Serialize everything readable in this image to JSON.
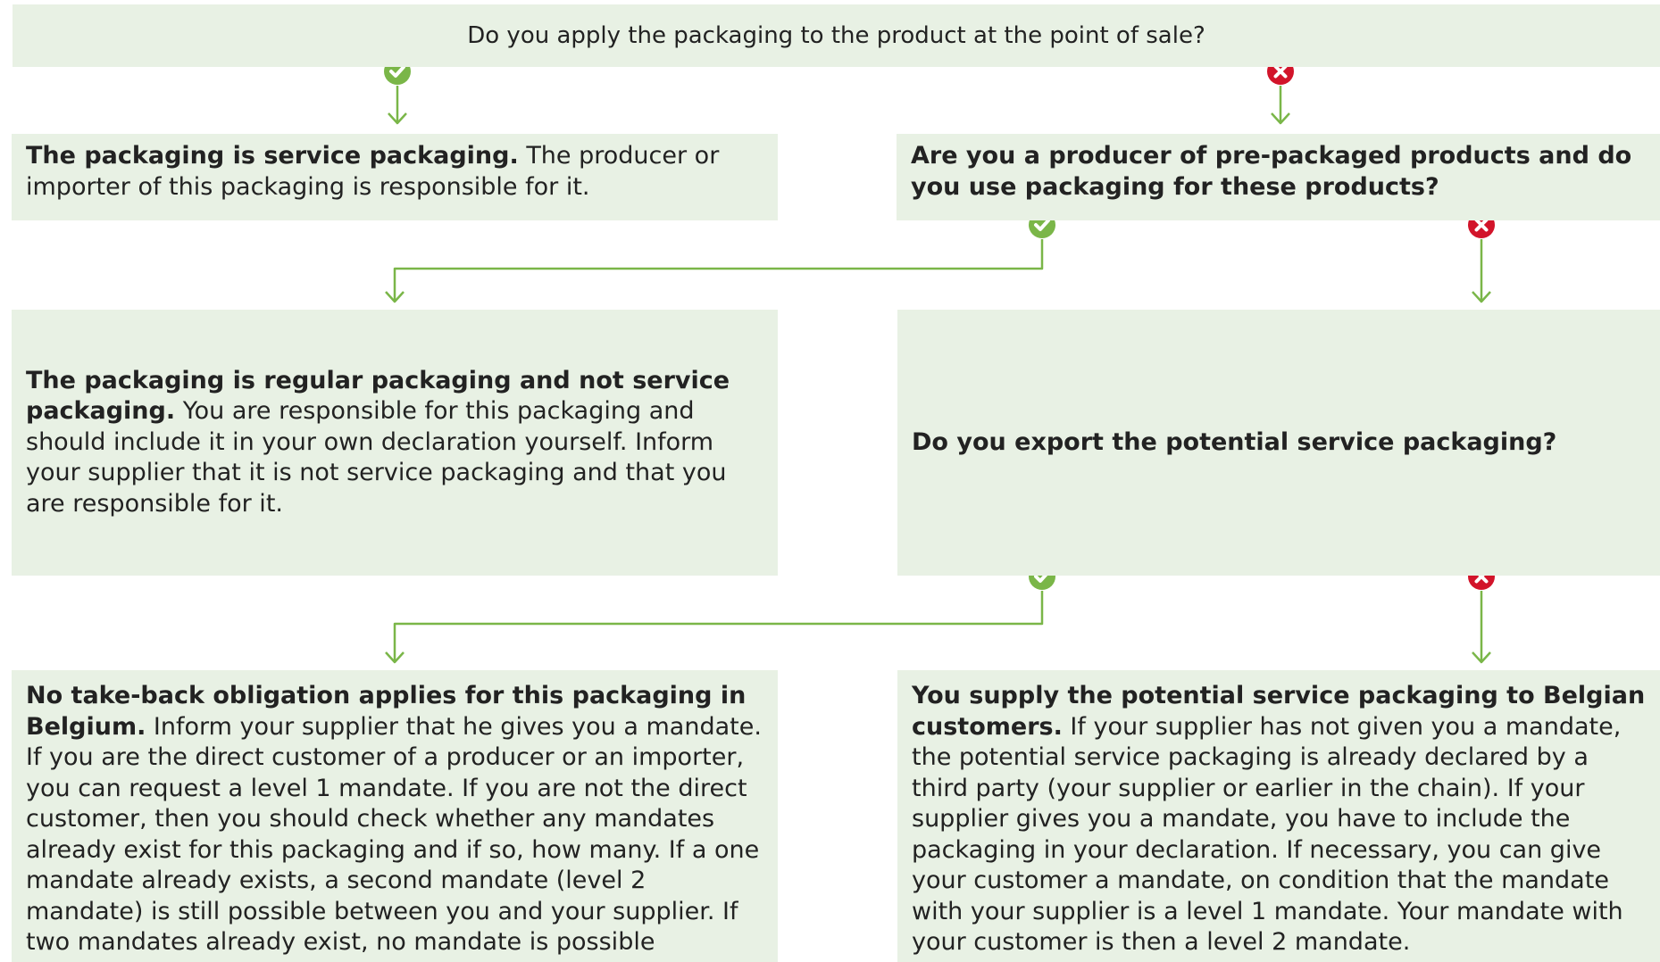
{
  "colors": {
    "box_fill": "#e8f1e4",
    "connector": "#7ab648",
    "yes_icon": "#7ab648",
    "no_icon": "#d2142a",
    "text": "#222222"
  },
  "question_top": "Do you apply the packaging to the product at the point of sale?",
  "box_service": {
    "lead": "The packaging is service packaging.",
    "body": " The producer or importer of this packaging is responsible for it."
  },
  "question_producer": "Are you a producer of pre-packaged products and do you use packaging for these products?",
  "box_regular": {
    "lead": "The packaging is regular packaging and not service packaging.",
    "body": " You are responsible for this packaging and should include it in your own declaration yourself. Inform your supplier that it is not service packaging and that you are responsible for it."
  },
  "question_export": "Do you export the potential service packaging?",
  "box_no_takeback": {
    "lead": "No take-back obligation applies for this packaging in Belgium.",
    "body": " Inform your supplier that he gives you a mandate. If you are the direct customer of a producer or an importer, you can request a level 1 mandate. If you are not the direct customer, then you should check whether any mandates already exist for this packaging and if so, how many. If a one mandate already exists, a second mandate (level 2 mandate) is still possible between you and your supplier. If two mandates already exist, no mandate is possible between you and your supplier."
  },
  "box_belgian": {
    "lead": "You supply the potential service packaging to Belgian customers.",
    "body": " If your supplier has not given you a mandate, the potential service packaging is already declared by a third party (your supplier or earlier in the chain). If your supplier gives you a mandate, you have to include the packaging in your declaration. If necessary, you can give your customer a mandate, on condition that the mandate with your supplier is a level 1 mandate. Your mandate with your customer is then a level 2 mandate."
  },
  "icons": {
    "yes": "check-circle-icon",
    "no": "cross-circle-icon"
  }
}
